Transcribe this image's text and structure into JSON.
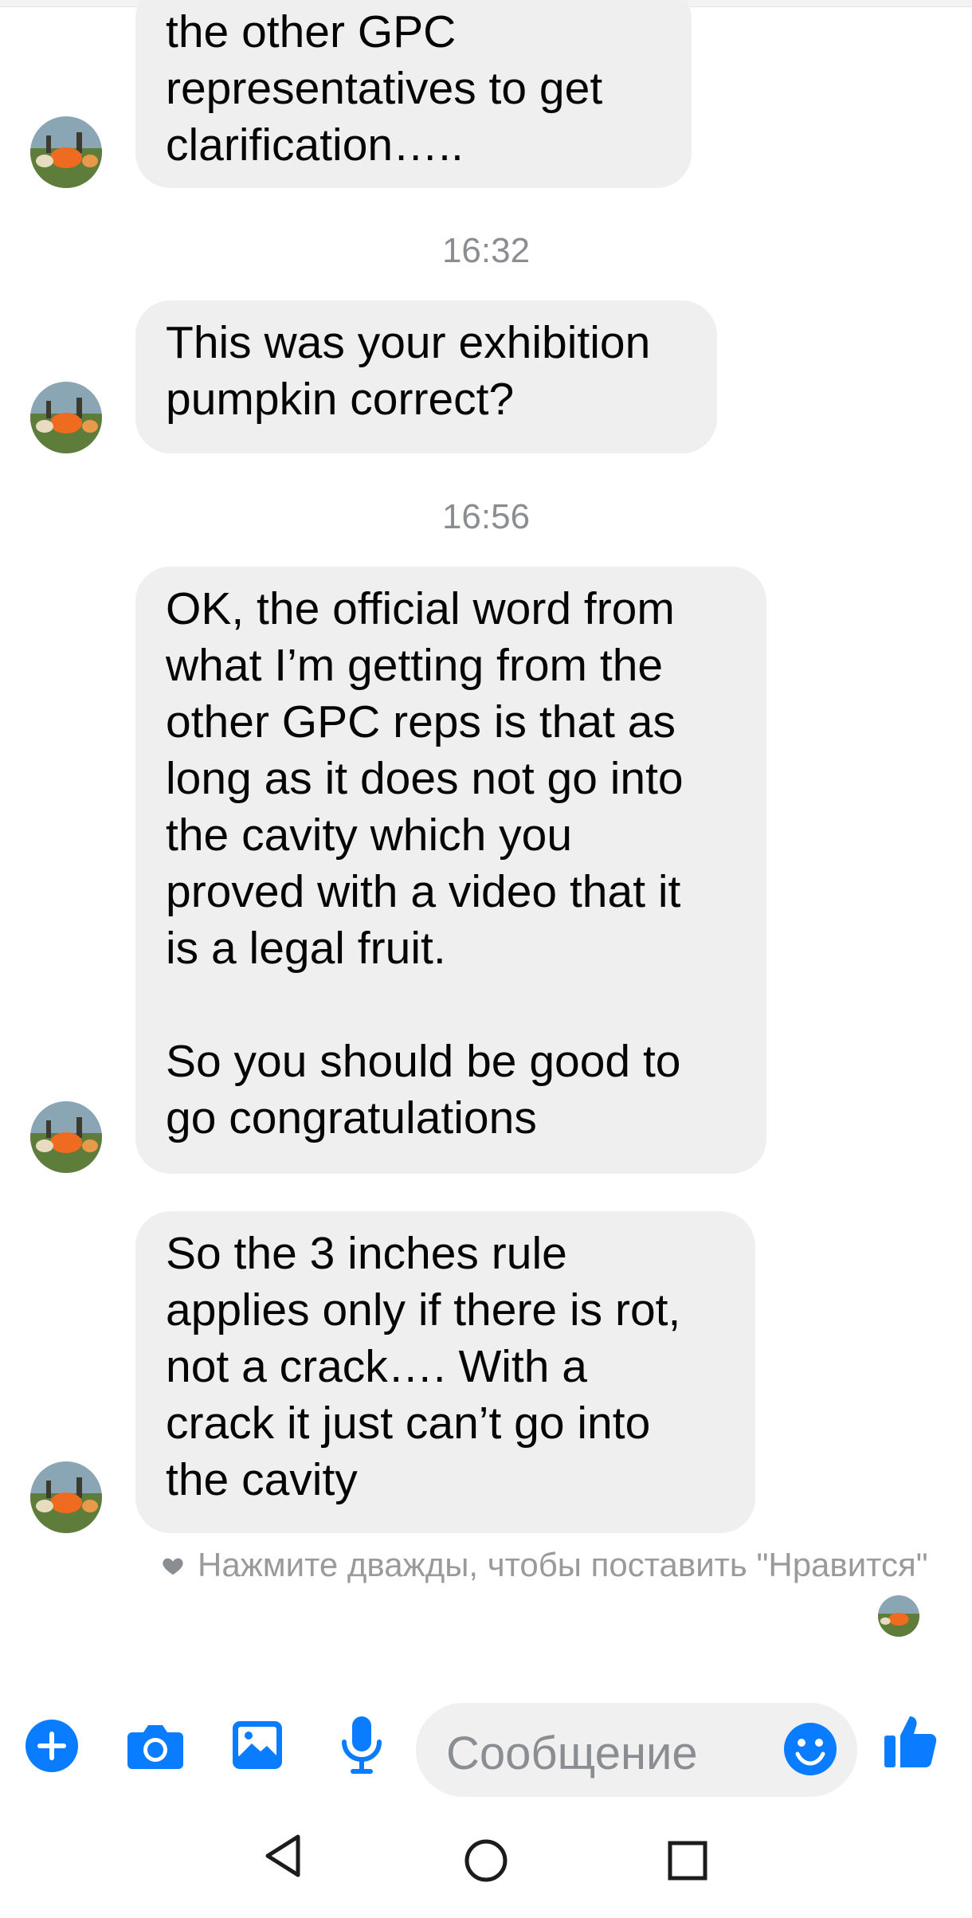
{
  "conversation": {
    "messages": [
      {
        "text": "the other GPC\nrepresentatives to get\nclarification….."
      },
      {
        "text": "This was your exhibition\npumpkin correct?"
      },
      {
        "text": "OK, the official word from\nwhat I’m getting from the\nother GPC reps is that as\nlong as it does not go into\nthe cavity which you\nproved with a video that it\nis a legal fruit.\n\nSo you should be good to\ngo congratulations"
      },
      {
        "text": "So the 3 inches rule\napplies only if there is rot,\nnot a crack…. With a\ncrack it just can’t go into\nthe cavity"
      }
    ],
    "timestamps": [
      "16:32",
      "16:56"
    ],
    "like_hint": "Нажмите дважды, чтобы поставить \"Нравится\""
  },
  "composer": {
    "placeholder": "Сообщение",
    "icons": [
      "plus-icon",
      "camera-icon",
      "gallery-icon",
      "microphone-icon",
      "emoji-icon",
      "thumbs-up-icon"
    ],
    "accent_color": "#0a7cff"
  },
  "system_nav": {
    "icons": [
      "back-icon",
      "home-icon",
      "recents-icon"
    ]
  }
}
